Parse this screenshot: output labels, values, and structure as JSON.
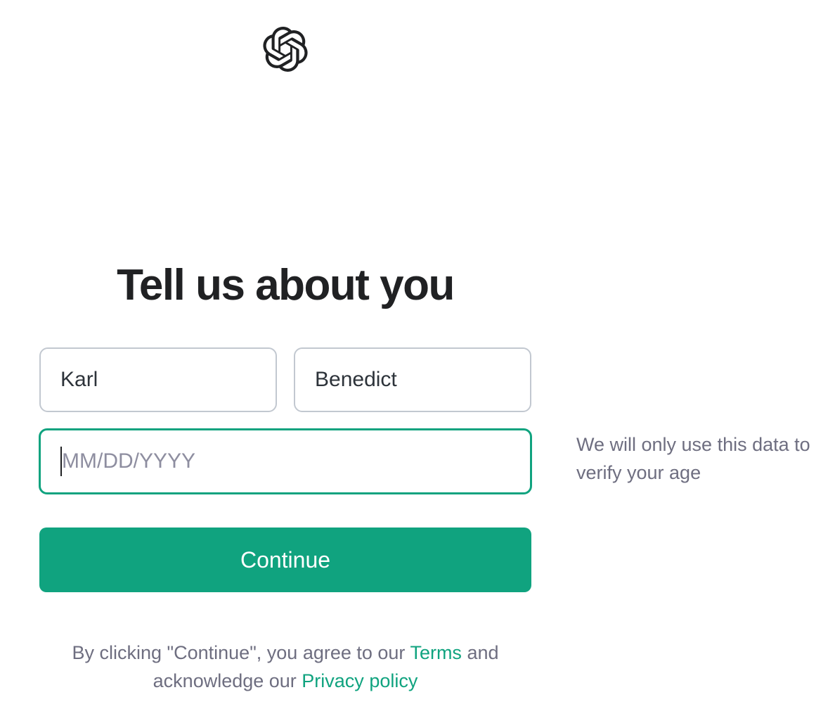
{
  "brand": {
    "logo_icon": "openai-logo-icon",
    "accent_color": "#10a37f"
  },
  "page": {
    "title": "Tell us about you"
  },
  "form": {
    "first_name": {
      "value": "Karl"
    },
    "last_name": {
      "value": "Benedict"
    },
    "birthday": {
      "value": "",
      "placeholder": "MM/DD/YYYY",
      "focused": true
    },
    "birthday_note": "We will only use this data to verify your age",
    "continue_label": "Continue"
  },
  "legal": {
    "text_before_terms": "By clicking \"Continue\", you agree to our ",
    "terms_label": "Terms",
    "text_between": " and acknowledge our ",
    "privacy_label": "Privacy policy"
  }
}
